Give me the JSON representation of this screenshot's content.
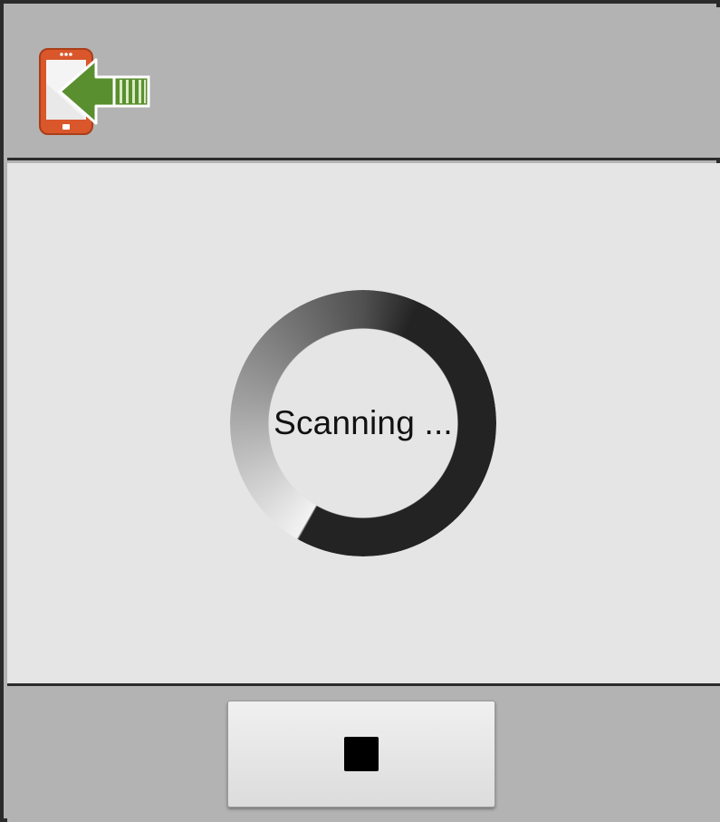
{
  "header": {
    "app_icon": "phone-transfer-arrow-icon"
  },
  "main": {
    "status_text": "Scanning ...",
    "spinner_icon": "progress-spinner-icon"
  },
  "footer": {
    "stop_button_icon": "stop-icon"
  },
  "colors": {
    "chrome_gray": "#b3b3b3",
    "content_bg": "#e5e5e5",
    "border": "#2b2b2b",
    "spinner_dark": "#232323",
    "phone_orange": "#d9572a",
    "arrow_green": "#5a8f2f"
  }
}
